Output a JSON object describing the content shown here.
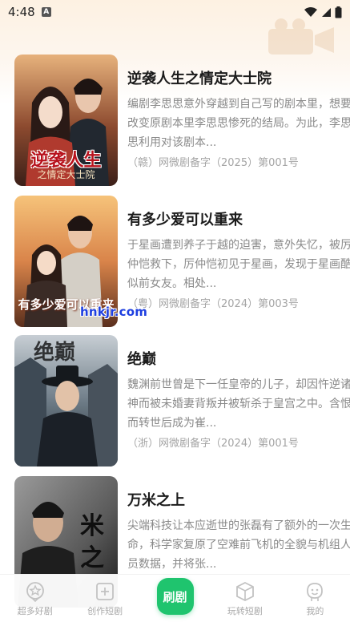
{
  "status_bar": {
    "time": "4:48",
    "app_icon_letter": "A"
  },
  "dramas": [
    {
      "title": "逆袭人生之情定大士院",
      "description": "编剧李思思意外穿越到自己写的剧本里，想要改变原剧本里李思思惨死的结局。为此，李思思利用对该剧本...",
      "license": "（赣）网微剧备字（2025）第001号",
      "poster_caption": "逆袭人生",
      "poster_subcaption": "之情定大士院",
      "poster_colors": [
        "#7a3b2a",
        "#d19a6a",
        "#3b1f18"
      ]
    },
    {
      "title": "有多少爱可以重来",
      "description": "于星画遭到养子于越的迫害，意外失忆，被厉仲恺救下，厉仲恺初见于星画，发现于星画酷似前女友。相处...",
      "license": "（粤）网微剧备字（2024）第003号",
      "poster_caption": "有多少爱可以重来",
      "poster_subcaption": "",
      "poster_colors": [
        "#c9773c",
        "#f2b46b",
        "#6b3a22"
      ]
    },
    {
      "title": "绝巅",
      "description": "魏渊前世曾是下一任皇帝的儿子，却因忤逆诸神而被未婚妻背叛并被斩杀于皇宫之中。含恨而转世后成为崔...",
      "license": "（浙）网微剧备字（2024）第001号",
      "poster_caption": "",
      "poster_subcaption": "",
      "poster_colors": [
        "#5b6d7e",
        "#a9b4bd",
        "#1d252d"
      ]
    },
    {
      "title": "万米之上",
      "description": "尖端科技让本应逝世的张磊有了额外的一次生命，科学家复原了空难前飞机的全貌与机组人员数据，并将张...",
      "license": "",
      "poster_caption": "",
      "poster_subcaption": "",
      "poster_colors": [
        "#3b3b3b",
        "#8a8a8a",
        "#1a1a1a"
      ]
    }
  ],
  "watermark": "hnkjr.com",
  "tabbar": {
    "tabs": [
      {
        "label": "超多好剧",
        "icon": "star-badge-icon"
      },
      {
        "label": "创作短剧",
        "icon": "add-square-icon"
      },
      {
        "label": "刷剧",
        "icon": "center-play"
      },
      {
        "label": "玩转短剧",
        "icon": "cube-icon"
      },
      {
        "label": "我的",
        "icon": "smiley-icon"
      }
    ],
    "active_color": "#1fc46e"
  }
}
